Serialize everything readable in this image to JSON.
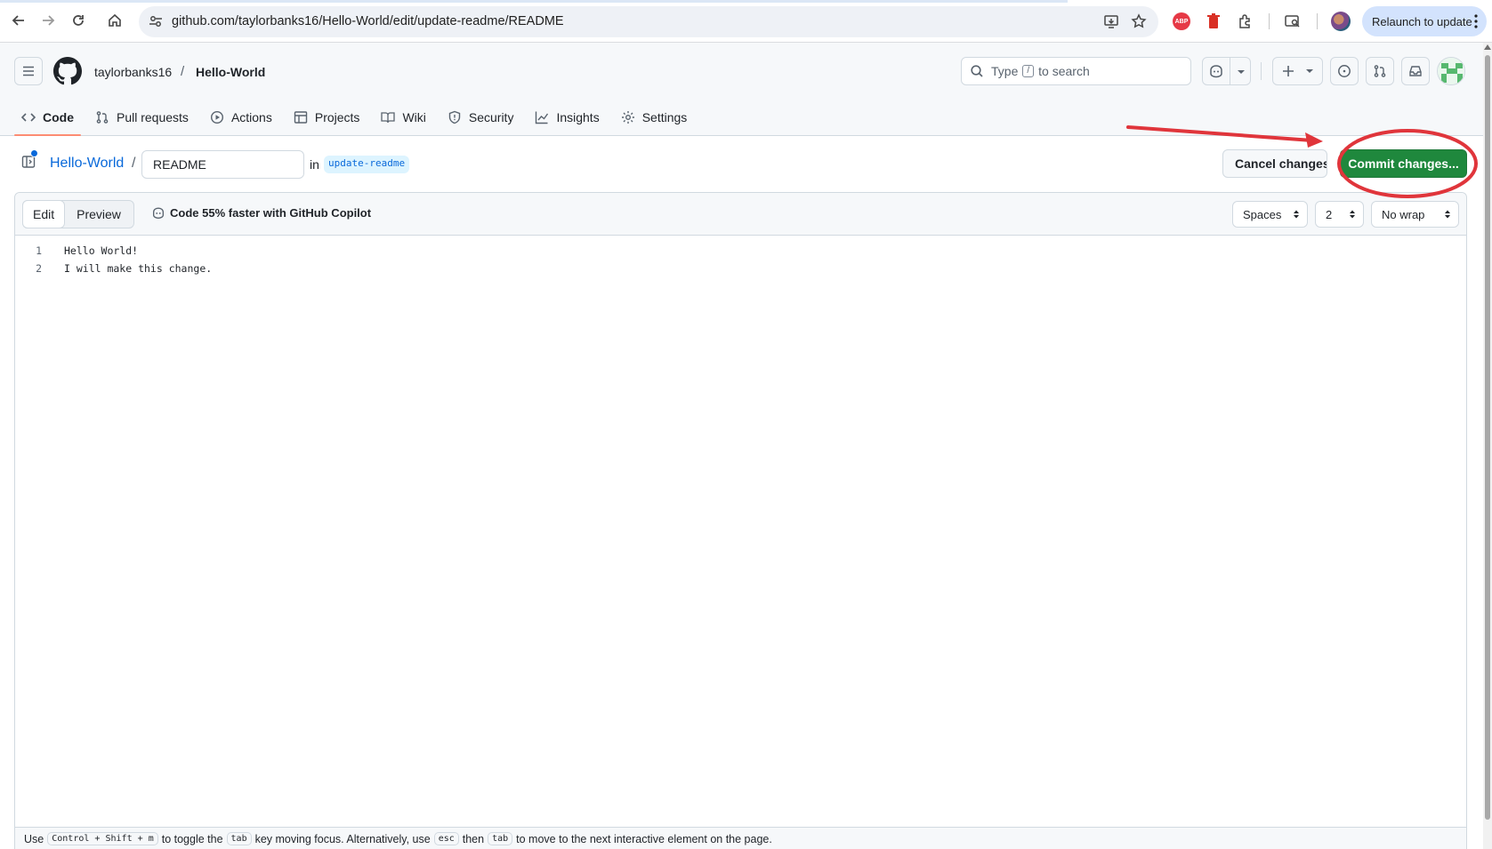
{
  "browser": {
    "url": "github.com/taylorbanks16/Hello-World/edit/update-readme/README",
    "relaunch_label": "Relaunch to update",
    "extension_abp_label": "ABP"
  },
  "header": {
    "owner": "taylorbanks16",
    "slash": "/",
    "repo": "Hello-World",
    "search_prefix": "Type",
    "search_key": "/",
    "search_suffix": "to search"
  },
  "repo_nav": [
    {
      "label": "Code",
      "icon": "code-icon",
      "active": true
    },
    {
      "label": "Pull requests",
      "icon": "git-pull-request-icon"
    },
    {
      "label": "Actions",
      "icon": "play-icon"
    },
    {
      "label": "Projects",
      "icon": "table-icon"
    },
    {
      "label": "Wiki",
      "icon": "book-icon"
    },
    {
      "label": "Security",
      "icon": "shield-icon"
    },
    {
      "label": "Insights",
      "icon": "graph-icon"
    },
    {
      "label": "Settings",
      "icon": "gear-icon"
    }
  ],
  "file_bar": {
    "repo_link": "Hello-World",
    "slash": "/",
    "file_name": "README",
    "in_label": "in",
    "branch": "update-readme",
    "cancel_label": "Cancel changes",
    "commit_label": "Commit changes..."
  },
  "editor": {
    "tab_edit": "Edit",
    "tab_preview": "Preview",
    "copilot_text": "Code 55% faster with GitHub Copilot",
    "indent_mode": "Spaces",
    "indent_size": "2",
    "wrap_mode": "No wrap",
    "lines": [
      {
        "num": "1",
        "text": "Hello World!"
      },
      {
        "num": "2",
        "text": "I will make this change."
      }
    ]
  },
  "footer_hint": {
    "use": "Use",
    "key_ctrl": "Control",
    "plus1": "+",
    "key_shift": "Shift",
    "plus2": "+",
    "key_m": "m",
    "to_toggle": "to toggle the",
    "key_tab": "tab",
    "key_moving": "key moving focus. Alternatively, use",
    "key_esc": "esc",
    "then": "then",
    "key_tab2": "tab",
    "tail": "to move to the next interactive element on the page."
  },
  "colors": {
    "commit_green": "#1f883d",
    "link_blue": "#0969da",
    "annotation_red": "#e0353b",
    "active_tab_underline": "#fd8c73"
  }
}
